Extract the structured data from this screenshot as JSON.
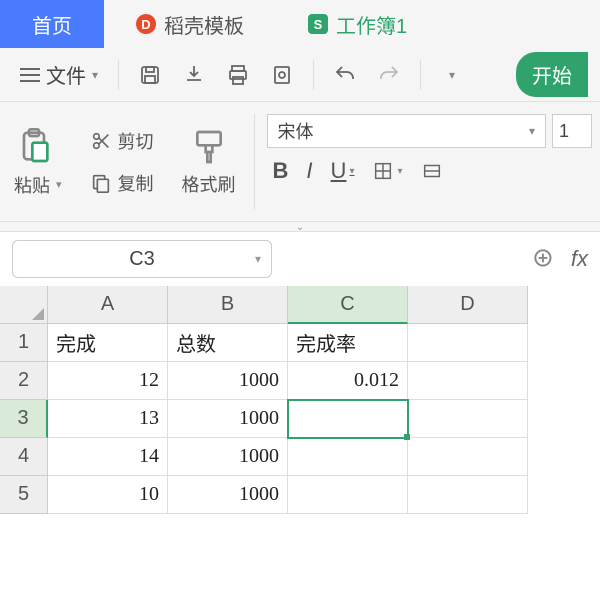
{
  "tabs": {
    "home": "首页",
    "template": "稻壳模板",
    "workbook": "工作簿1"
  },
  "menu": {
    "file": "文件"
  },
  "ribbon": {
    "start_tab": "开始",
    "paste": "粘贴",
    "cut": "剪切",
    "copy": "复制",
    "format_painter": "格式刷",
    "font_name": "宋体",
    "font_size": "1",
    "bold": "B",
    "italic": "I",
    "underline": "U"
  },
  "namebox": {
    "value": "C3"
  },
  "formula": {
    "fx": "fx"
  },
  "sheet": {
    "cols": [
      "A",
      "B",
      "C",
      "D"
    ],
    "rows": [
      "1",
      "2",
      "3",
      "4",
      "5"
    ],
    "headers": {
      "A": "完成",
      "B": "总数",
      "C": "完成率"
    },
    "data": [
      {
        "A": "12",
        "B": "1000",
        "C": "0.012"
      },
      {
        "A": "13",
        "B": "1000",
        "C": ""
      },
      {
        "A": "14",
        "B": "1000",
        "C": ""
      },
      {
        "A": "10",
        "B": "1000",
        "C": ""
      }
    ],
    "selected": "C3"
  }
}
